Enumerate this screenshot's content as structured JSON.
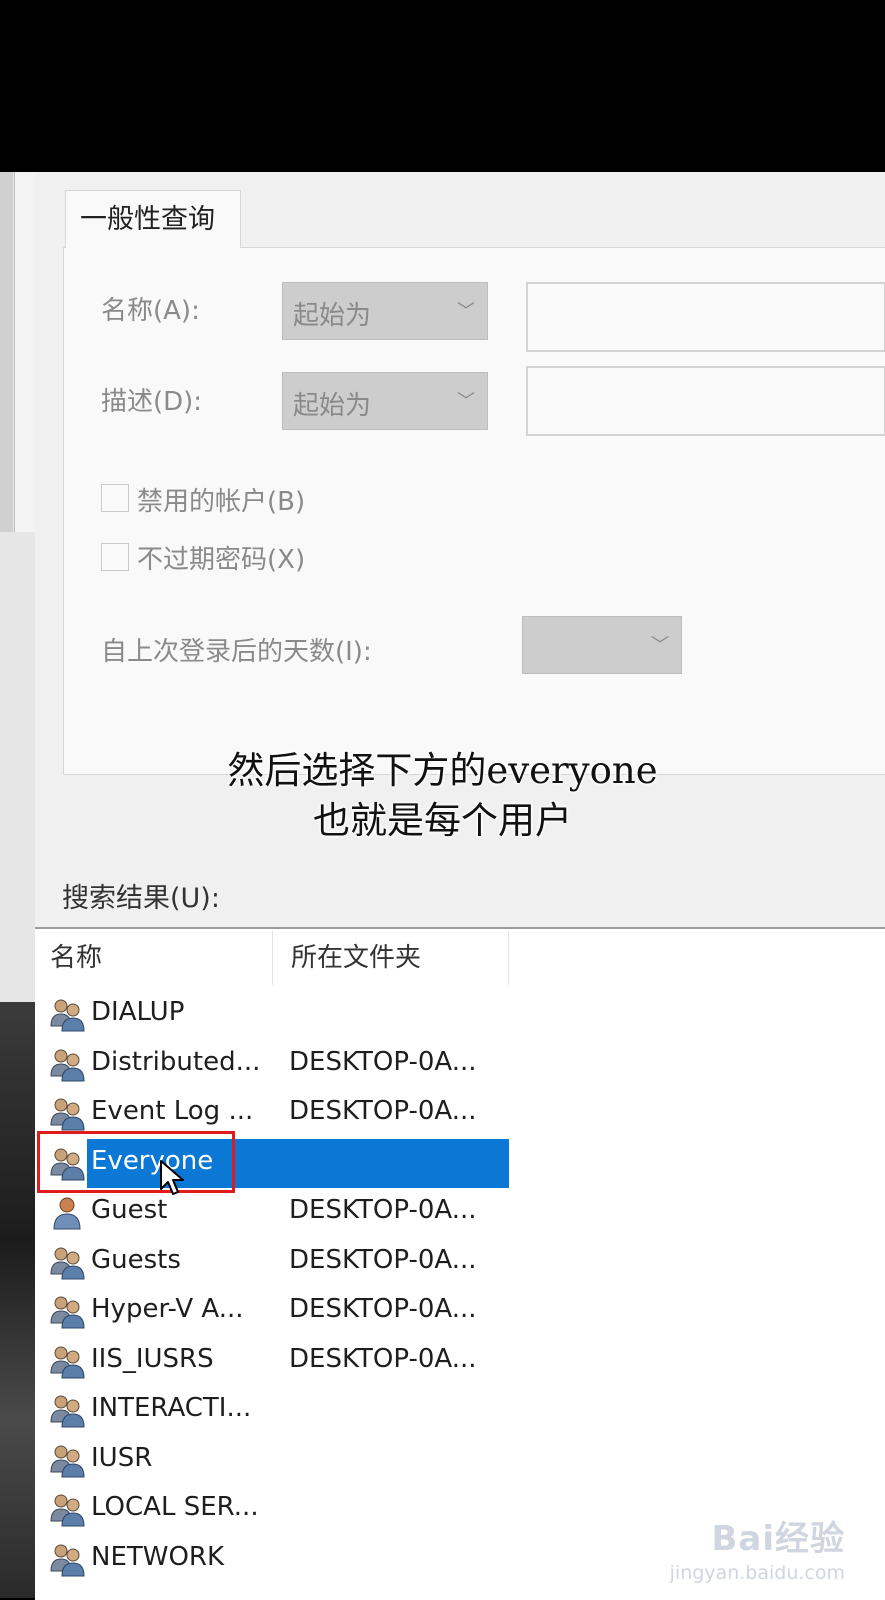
{
  "video_subtitle": {
    "line1": "然后选择下方的everyone",
    "line2": "也就是每个用户"
  },
  "dialog": {
    "tab_label": "一般性查询",
    "name_label": "名称(A):",
    "name_mode": "起始为",
    "desc_label": "描述(D):",
    "desc_mode": "起始为",
    "disabled_accounts_label": "禁用的帐户(B)",
    "non_expiring_pw_label": "不过期密码(X)",
    "days_since_login_label": "自上次登录后的天数(I):",
    "results_label": "搜索结果(U):",
    "columns": {
      "name": "名称",
      "folder": "所在文件夹"
    },
    "rows": [
      {
        "name": "DIALUP",
        "folder": "",
        "icon": "group-icon"
      },
      {
        "name": "Distributed...",
        "folder": "DESKTOP-0A...",
        "icon": "group-icon"
      },
      {
        "name": "Event Log ...",
        "folder": "DESKTOP-0A...",
        "icon": "group-icon"
      },
      {
        "name": "Everyone",
        "folder": "",
        "icon": "group-icon",
        "selected": true
      },
      {
        "name": "Guest",
        "folder": "DESKTOP-0A...",
        "icon": "user-icon"
      },
      {
        "name": "Guests",
        "folder": "DESKTOP-0A...",
        "icon": "group-icon"
      },
      {
        "name": "Hyper-V A...",
        "folder": "DESKTOP-0A...",
        "icon": "group-icon"
      },
      {
        "name": "IIS_IUSRS",
        "folder": "DESKTOP-0A...",
        "icon": "group-icon"
      },
      {
        "name": "INTERACTI...",
        "folder": "",
        "icon": "group-icon"
      },
      {
        "name": "IUSR",
        "folder": "",
        "icon": "group-icon"
      },
      {
        "name": "LOCAL SER...",
        "folder": "",
        "icon": "group-icon"
      },
      {
        "name": "NETWORK",
        "folder": "",
        "icon": "group-icon"
      }
    ]
  },
  "watermark": {
    "logo": "Bai经验",
    "url": "jingyan.baidu.com"
  },
  "colors": {
    "selection": "#0b78d6",
    "highlight_box": "#e01b1b"
  }
}
